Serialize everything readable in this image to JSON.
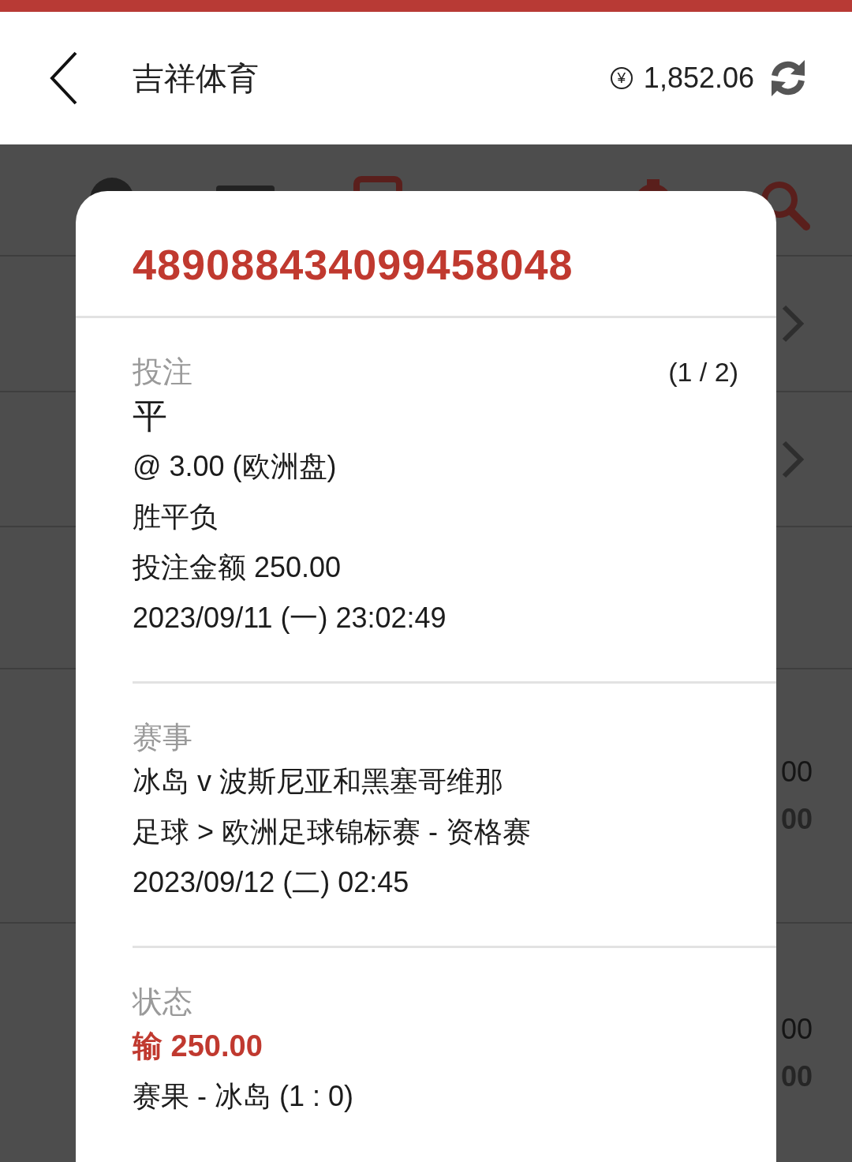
{
  "header": {
    "title": "吉祥体育",
    "currency_symbol": "¥",
    "balance": "1,852.06"
  },
  "background": {
    "rows": [
      {
        "kind": "chevron"
      },
      {
        "kind": "chevron"
      },
      {
        "kind": "blank"
      },
      {
        "kind": "amounts",
        "amounts": [
          {
            "text": "00",
            "bold": false
          },
          {
            "text": "00",
            "bold": true
          }
        ]
      },
      {
        "kind": "amounts",
        "amounts": [
          {
            "text": "00",
            "bold": false
          },
          {
            "text": "00",
            "bold": true
          }
        ]
      }
    ]
  },
  "modal": {
    "bet_id": "489088434099458048",
    "sections": [
      {
        "label": "投注",
        "counter": "(1 / 2)",
        "lines": [
          {
            "kind": "big",
            "text": "平"
          },
          {
            "kind": "normal",
            "text": "@ 3.00 (欧洲盘)"
          },
          {
            "kind": "normal",
            "text": "胜平负"
          },
          {
            "kind": "normal",
            "text": "投注金额 250.00"
          },
          {
            "kind": "normal",
            "text": "2023/09/11 (一) 23:02:49"
          }
        ]
      },
      {
        "label": "赛事",
        "lines": [
          {
            "kind": "normal",
            "text": "冰岛 v 波斯尼亚和黑塞哥维那"
          },
          {
            "kind": "normal",
            "text": "足球 > 欧洲足球锦标赛 - 资格赛"
          },
          {
            "kind": "normal",
            "text": "2023/09/12 (二) 02:45"
          }
        ]
      },
      {
        "label": "状态",
        "lines": [
          {
            "kind": "loss",
            "text": "输 250.00"
          },
          {
            "kind": "normal",
            "text": "赛果 - 冰岛 (1 : 0)"
          }
        ]
      }
    ]
  }
}
